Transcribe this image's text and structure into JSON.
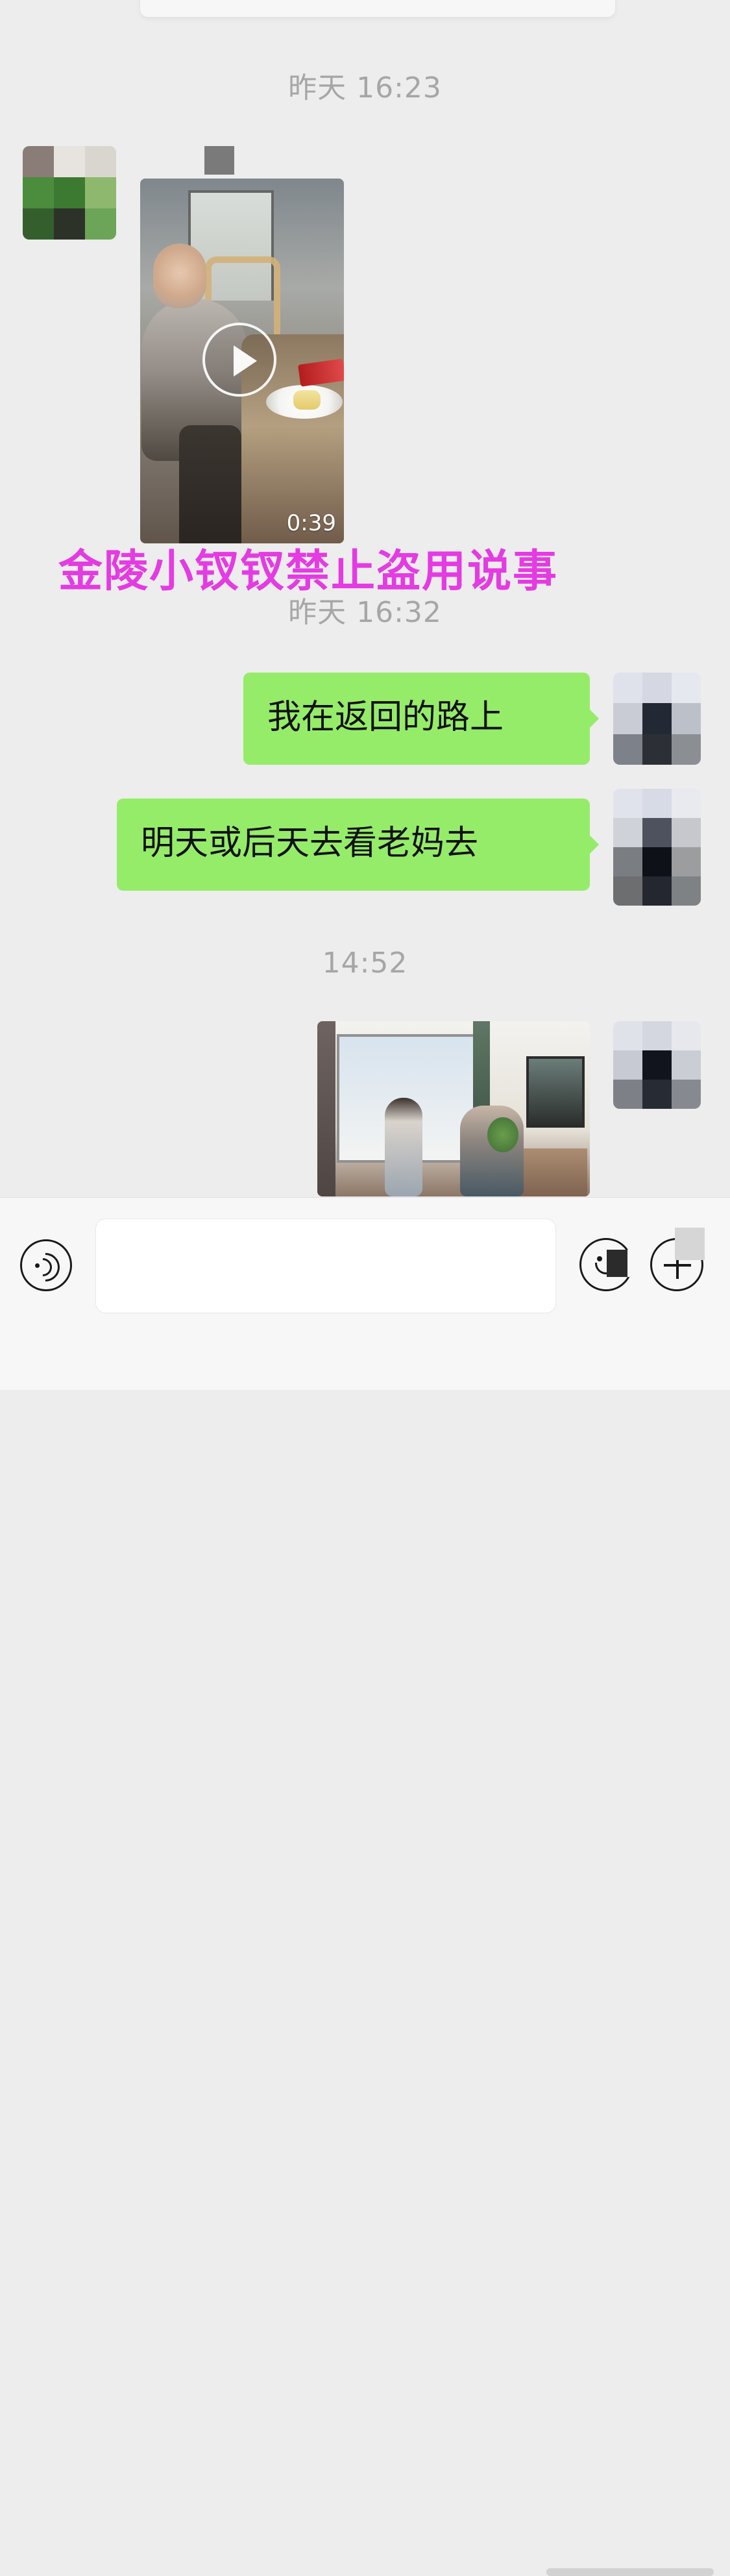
{
  "timestamps": {
    "first": "昨天 16:23",
    "second": "昨天 16:32",
    "third": "14:52"
  },
  "video_message": {
    "duration": "0:39"
  },
  "watermark": {
    "text": "金陵小钗钗禁止盗用说事"
  },
  "messages": [
    {
      "text": "我在返回的路上"
    },
    {
      "text": "明天或后天去看老妈去"
    }
  ],
  "input_bar": {
    "placeholder": ""
  },
  "colors": {
    "bubble_green": "#95ec69",
    "timestamp_gray": "#a6a6a6",
    "watermark_magenta": "#e43be2",
    "chat_background": "#ededed"
  },
  "icons": {
    "voice": "voice-icon",
    "emoji": "emoji-icon",
    "add": "plus-icon",
    "play": "play-icon"
  }
}
